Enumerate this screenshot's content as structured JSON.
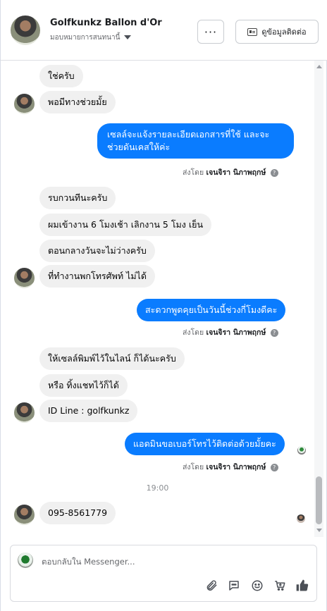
{
  "header": {
    "name": "Golfkunkz Ballon d'Or",
    "assign": "มอบหมายการสนทนานี้",
    "more_label": "···",
    "contact_label": "ดูข้อมูลติดต่อ"
  },
  "messages": [
    {
      "text": "ใช่ครับ"
    },
    {
      "text": "พอมีทางช่วยมั้ย"
    },
    {
      "line1": "เซลล์จะแจ้งรายละเอียดเอกสารที่ใช้ และจะ",
      "line2": "ช่วยดันเคสให้ค่ะ"
    },
    {
      "text": "รบกวนทีนะครับ"
    },
    {
      "text": "ผมเข้างาน 6 โมงเช้า เลิกงาน 5 โมง เย็น"
    },
    {
      "text": "ตอนกลางวันจะไม่ว่างครับ"
    },
    {
      "text": "ที่ทำงานพกโทรศัพท์ ไม่ได้"
    },
    {
      "text": "สะดวกพูดคุยเป็นวันนี้ช่วงกี่โมงดีคะ"
    },
    {
      "text": "ให้เซลล์พิมพ์ไว้ในไลน์ ก็ได้นะครับ"
    },
    {
      "text": "หรือ ทิ้งแชทไว้ก็ได้"
    },
    {
      "text": "ID Line : golfkunkz"
    },
    {
      "text": "แอดมินขอเบอร์โทรไว้ติดต่อด้วยมั้ยคะ"
    },
    {
      "text": "095-8561779"
    }
  ],
  "sent_by": {
    "prefix": "ส่งโดย",
    "agent": "เจนจิรา นิภาพฤกษ์",
    "info_icon": "?"
  },
  "time_separator": "19:00",
  "composer": {
    "placeholder": "ตอบกลับใน Messenger...",
    "icons": [
      "attachment-icon",
      "saved-reply-icon",
      "emoji-icon",
      "cart-icon",
      "like-icon"
    ]
  },
  "colors": {
    "outgoing_bubble": "#0a7cff",
    "incoming_bubble": "#f0f0f0"
  }
}
